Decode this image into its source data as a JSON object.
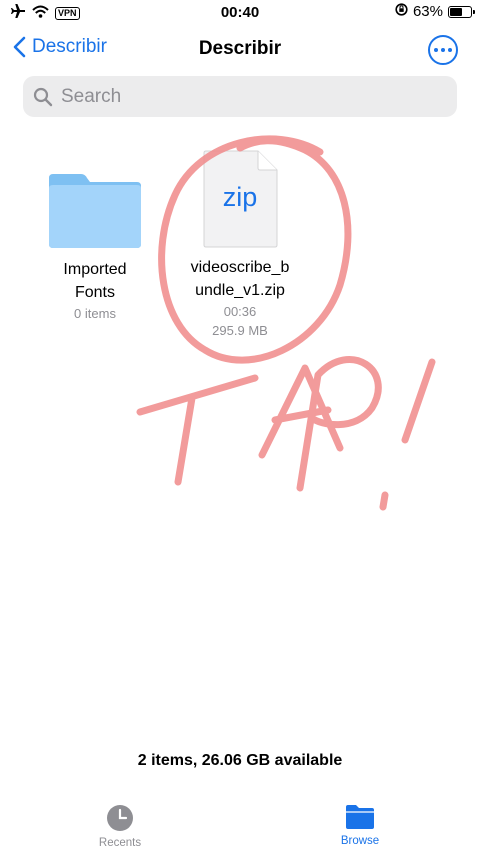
{
  "status_bar": {
    "vpn": "VPN",
    "time": "00:40",
    "battery": "63%",
    "battery_level": 0.63
  },
  "nav": {
    "back_label": "Describir",
    "title": "Describir"
  },
  "search": {
    "placeholder": "Search"
  },
  "items": [
    {
      "name_line1": "Imported",
      "name_line2": "Fonts",
      "detail": "0 items",
      "icon": "folder-icon"
    },
    {
      "name_line1": "videoscribe_b",
      "name_line2": "undle_v1.zip",
      "time": "00:36",
      "size": "295.9 MB",
      "icon_label": "zip",
      "icon": "zip-file-icon"
    }
  ],
  "footer": {
    "summary": "2 items, 26.06 GB available"
  },
  "tabs": [
    {
      "label": "Recents",
      "icon": "clock-icon",
      "color": "#8e8e93"
    },
    {
      "label": "Browse",
      "icon": "folder-icon",
      "color": "#1a73e8"
    }
  ],
  "annotation": {
    "text": "TAP!",
    "color": "#f08a8a"
  }
}
